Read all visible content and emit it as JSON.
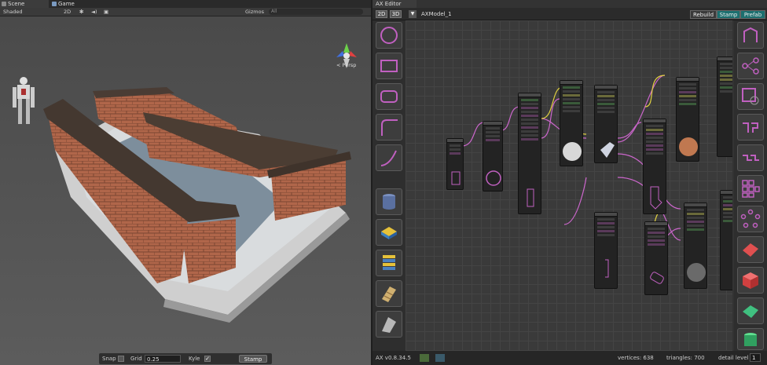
{
  "scene": {
    "tabs": [
      {
        "label": "Scene",
        "active": true
      },
      {
        "label": "Game",
        "active": false
      }
    ],
    "toolbar": {
      "shading": "Shaded",
      "mode_2d": "2D",
      "gizmos": "Gizmos",
      "search_placeholder": "All"
    },
    "persp_label": "< Persp",
    "bottom": {
      "snap_label": "Snap",
      "snap_checked": false,
      "grid_label": "Grid",
      "grid_value": "0.25",
      "kyle_label": "Kyle",
      "kyle_checked": true,
      "stamp_label": "Stamp"
    }
  },
  "ax_editor": {
    "tab_label": "AX Editor",
    "mode_buttons": [
      "2D",
      "3D"
    ],
    "model_name": "AXModel_1",
    "buttons": {
      "rebuild": "Rebuild",
      "stamp": "Stamp",
      "prefab": "Prefab"
    },
    "left_palette": [
      "circle-shape-icon",
      "rectangle-shape-icon",
      "rounded-rect-shape-icon",
      "corner-shape-icon",
      "curve-shape-icon",
      "cylinder-icon",
      "box-extrude-icon",
      "stack-icon",
      "stair-icon",
      "ramp-icon"
    ],
    "right_palette": [
      "shape-merger-icon",
      "shape-distributor-icon",
      "offset-icon",
      "corner-pair-icon",
      "steps-icon",
      "grid-repeat-icon",
      "radial-repeat-icon",
      "plane-icon",
      "cube-icon",
      "polygon-icon",
      "cylinder-green-icon"
    ],
    "status": {
      "version": "AX v0.8.34.5",
      "vertices": "vertices: 638",
      "triangles": "triangles: 700",
      "detail_label": "detail level",
      "detail_value": "1"
    },
    "colors": {
      "wire_pink": "#cc66cc",
      "wire_yellow": "#e0d040",
      "accent_teal": "#1c6f6f"
    }
  }
}
